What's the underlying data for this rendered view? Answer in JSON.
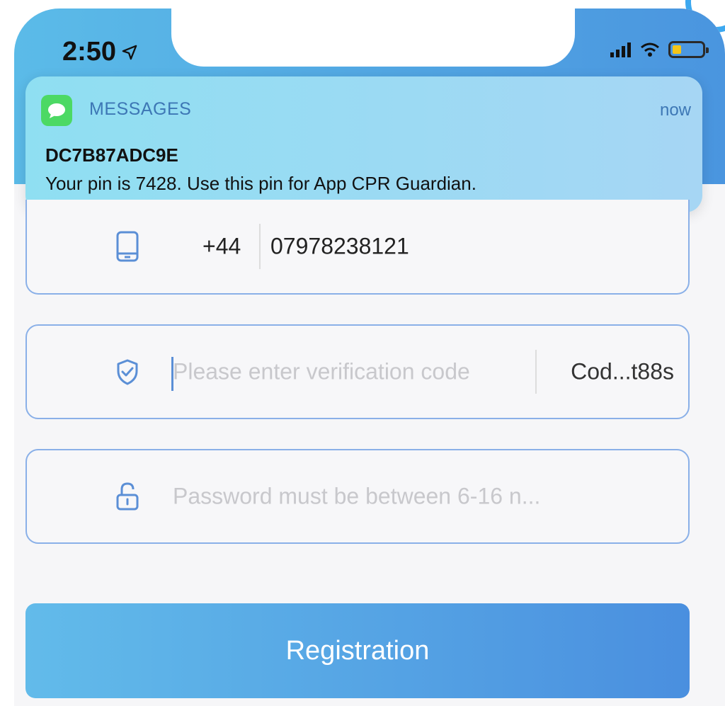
{
  "status_bar": {
    "time": "2:50"
  },
  "notification": {
    "app_name": "MESSAGES",
    "time": "now",
    "sender": "DC7B87ADC9E",
    "body": "Your pin is 7428. Use this pin for App CPR Guardian."
  },
  "form": {
    "phone": {
      "country_code": "+44",
      "number": "07978238121"
    },
    "verification": {
      "placeholder": "Please enter verification code",
      "code_button": "Cod...t88s"
    },
    "password": {
      "placeholder": "Password must be between 6-16 n..."
    }
  },
  "register_button": {
    "label": "Registration"
  },
  "colors": {
    "accent": "#4a8fdf",
    "header": "#5bbbe8",
    "field_border": "#8ab0e8"
  }
}
